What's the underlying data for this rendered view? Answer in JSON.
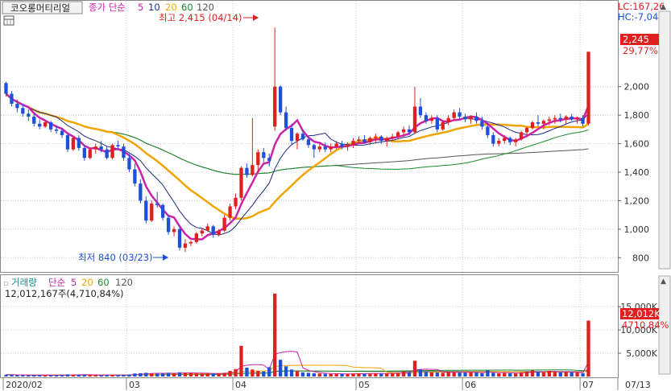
{
  "header": {
    "stock_name": "코오롱머티리얼",
    "price_ma_label": "종가 단순",
    "ma_periods": [
      "5",
      "10",
      "20",
      "60",
      "120"
    ],
    "lc_label": "LC:167,26",
    "hc_label": "HC:-7,04"
  },
  "volume_header": {
    "title": "거래량",
    "ma_label": "단순",
    "ma_periods": [
      "5",
      "20",
      "60",
      "120"
    ],
    "summary": "12,012,167주(4,710,84%)"
  },
  "annotations": {
    "high": "최고 2,415 (04/14)",
    "low": "최저 840 (03/23)"
  },
  "price_badge": {
    "value": "2,245",
    "change": "29,77%"
  },
  "volume_badge": {
    "value": "12,012K",
    "change": "4710,84%"
  },
  "colors": {
    "up": "#e02020",
    "down": "#1f50d8",
    "ma5": "#cc22aa",
    "ma10": "#1a2a88",
    "ma20": "#f0a500",
    "ma60": "#1a8a2a",
    "ma120": "#555555",
    "grid": "#c8c8c8"
  },
  "icons": {
    "window": "window-icon"
  },
  "chart_data": [
    {
      "type": "candlestick",
      "name": "price",
      "ylim": [
        700,
        2450
      ],
      "y_ticks": [
        "800",
        "1,000",
        "1,200",
        "1,400",
        "1,600",
        "1,800",
        "2,000"
      ],
      "x_labels": [
        "2020/02",
        "03",
        "04",
        "05",
        "06",
        "07"
      ],
      "x_label_index": [
        0,
        22,
        41,
        63,
        82,
        103
      ],
      "x_end_label": "07/13",
      "last_close": 2245,
      "change_pct": 29.77,
      "high": {
        "value": 2415,
        "date": "04/14",
        "index": 48
      },
      "low": {
        "value": 840,
        "date": "03/23",
        "index": 32
      },
      "ohlc": [
        [
          2025,
          2035,
          1930,
          1950
        ],
        [
          1950,
          1970,
          1860,
          1880
        ],
        [
          1880,
          1910,
          1820,
          1850
        ],
        [
          1850,
          1880,
          1790,
          1810
        ],
        [
          1810,
          1840,
          1760,
          1790
        ],
        [
          1790,
          1810,
          1720,
          1740
        ],
        [
          1740,
          1770,
          1700,
          1720
        ],
        [
          1720,
          1760,
          1710,
          1750
        ],
        [
          1750,
          1760,
          1680,
          1700
        ],
        [
          1700,
          1730,
          1670,
          1690
        ],
        [
          1690,
          1710,
          1640,
          1660
        ],
        [
          1660,
          1670,
          1540,
          1560
        ],
        [
          1560,
          1650,
          1550,
          1640
        ],
        [
          1640,
          1660,
          1550,
          1570
        ],
        [
          1570,
          1590,
          1480,
          1500
        ],
        [
          1500,
          1570,
          1490,
          1560
        ],
        [
          1560,
          1600,
          1530,
          1580
        ],
        [
          1580,
          1620,
          1540,
          1560
        ],
        [
          1560,
          1580,
          1490,
          1500
        ],
        [
          1500,
          1600,
          1490,
          1590
        ],
        [
          1590,
          1620,
          1560,
          1580
        ],
        [
          1580,
          1600,
          1480,
          1500
        ],
        [
          1500,
          1530,
          1400,
          1420
        ],
        [
          1420,
          1460,
          1300,
          1320
        ],
        [
          1320,
          1350,
          1180,
          1200
        ],
        [
          1200,
          1230,
          1040,
          1060
        ],
        [
          1060,
          1200,
          1050,
          1180
        ],
        [
          1180,
          1260,
          1150,
          1170
        ],
        [
          1170,
          1180,
          1060,
          1080
        ],
        [
          1080,
          1100,
          960,
          980
        ],
        [
          980,
          1020,
          950,
          1000
        ],
        [
          1000,
          1020,
          850,
          870
        ],
        [
          870,
          930,
          840,
          900
        ],
        [
          900,
          920,
          880,
          910
        ],
        [
          910,
          980,
          900,
          970
        ],
        [
          970,
          1010,
          950,
          990
        ],
        [
          990,
          1040,
          980,
          1020
        ],
        [
          1020,
          1030,
          940,
          960
        ],
        [
          960,
          1000,
          950,
          990
        ],
        [
          990,
          1100,
          980,
          1080
        ],
        [
          1080,
          1180,
          1060,
          1160
        ],
        [
          1160,
          1250,
          1140,
          1220
        ],
        [
          1220,
          1440,
          1200,
          1430
        ],
        [
          1430,
          1460,
          1360,
          1380
        ],
        [
          1380,
          1780,
          1370,
          1450
        ],
        [
          1450,
          1560,
          1400,
          1540
        ],
        [
          1540,
          1570,
          1470,
          1500
        ],
        [
          1500,
          1530,
          1440,
          1480
        ],
        [
          1720,
          2415,
          1690,
          2000
        ],
        [
          2000,
          2010,
          1800,
          1820
        ],
        [
          1820,
          1860,
          1690,
          1710
        ],
        [
          1710,
          1740,
          1590,
          1620
        ],
        [
          1620,
          1680,
          1560,
          1670
        ],
        [
          1670,
          1700,
          1620,
          1630
        ],
        [
          1630,
          1650,
          1570,
          1590
        ],
        [
          1590,
          1600,
          1500,
          1560
        ],
        [
          1560,
          1600,
          1540,
          1580
        ],
        [
          1580,
          1610,
          1540,
          1560
        ],
        [
          1560,
          1600,
          1540,
          1580
        ],
        [
          1580,
          1620,
          1560,
          1600
        ],
        [
          1600,
          1620,
          1560,
          1580
        ],
        [
          1580,
          1610,
          1550,
          1590
        ],
        [
          1590,
          1640,
          1570,
          1620
        ],
        [
          1620,
          1650,
          1600,
          1630
        ],
        [
          1630,
          1660,
          1600,
          1610
        ],
        [
          1610,
          1650,
          1590,
          1640
        ],
        [
          1640,
          1670,
          1610,
          1650
        ],
        [
          1650,
          1660,
          1600,
          1620
        ],
        [
          1620,
          1650,
          1580,
          1640
        ],
        [
          1640,
          1670,
          1620,
          1650
        ],
        [
          1650,
          1690,
          1630,
          1680
        ],
        [
          1680,
          1720,
          1650,
          1700
        ],
        [
          1700,
          1730,
          1660,
          1680
        ],
        [
          1680,
          2000,
          1670,
          1860
        ],
        [
          1860,
          1920,
          1780,
          1800
        ],
        [
          1800,
          1820,
          1740,
          1760
        ],
        [
          1760,
          1800,
          1740,
          1780
        ],
        [
          1780,
          1800,
          1680,
          1700
        ],
        [
          1700,
          1760,
          1690,
          1750
        ],
        [
          1750,
          1800,
          1730,
          1780
        ],
        [
          1780,
          1840,
          1760,
          1820
        ],
        [
          1820,
          1850,
          1770,
          1790
        ],
        [
          1790,
          1810,
          1750,
          1770
        ],
        [
          1770,
          1800,
          1740,
          1790
        ],
        [
          1790,
          1820,
          1740,
          1760
        ],
        [
          1760,
          1790,
          1700,
          1720
        ],
        [
          1720,
          1740,
          1640,
          1660
        ],
        [
          1660,
          1680,
          1580,
          1600
        ],
        [
          1600,
          1640,
          1580,
          1620
        ],
        [
          1620,
          1660,
          1600,
          1640
        ],
        [
          1640,
          1650,
          1590,
          1610
        ],
        [
          1610,
          1640,
          1580,
          1630
        ],
        [
          1630,
          1690,
          1620,
          1680
        ],
        [
          1680,
          1720,
          1660,
          1710
        ],
        [
          1710,
          1760,
          1700,
          1750
        ],
        [
          1750,
          1800,
          1720,
          1740
        ],
        [
          1740,
          1770,
          1700,
          1760
        ],
        [
          1760,
          1790,
          1730,
          1770
        ],
        [
          1770,
          1800,
          1740,
          1780
        ],
        [
          1780,
          1810,
          1750,
          1770
        ],
        [
          1770,
          1800,
          1740,
          1790
        ],
        [
          1790,
          1810,
          1760,
          1770
        ],
        [
          1770,
          1790,
          1740,
          1780
        ],
        [
          1780,
          1800,
          1720,
          1740
        ],
        [
          1740,
          2245,
          1730,
          2245
        ]
      ]
    },
    {
      "type": "bar",
      "name": "volume",
      "unit": "K",
      "ylim": [
        0,
        19000
      ],
      "y_ticks": [
        "5,000K",
        "10,000K",
        "15,000K"
      ],
      "last_value": 12012,
      "change_pct": 4710.84,
      "values": [
        380,
        350,
        320,
        300,
        280,
        320,
        300,
        260,
        280,
        300,
        320,
        450,
        380,
        350,
        400,
        330,
        300,
        280,
        320,
        350,
        300,
        380,
        420,
        650,
        720,
        800,
        700,
        600,
        650,
        800,
        700,
        900,
        850,
        700,
        650,
        600,
        700,
        650,
        600,
        800,
        1200,
        1600,
        6600,
        1900,
        1500,
        1200,
        1100,
        2000,
        17800,
        3600,
        2200,
        1500,
        1200,
        900,
        800,
        700,
        650,
        600,
        550,
        600,
        550,
        500,
        650,
        700,
        600,
        650,
        700,
        600,
        650,
        700,
        800,
        1100,
        900,
        3400,
        1500,
        1000,
        900,
        850,
        800,
        1000,
        900,
        850,
        800,
        900,
        850,
        700,
        1300,
        800,
        700,
        750,
        700,
        650,
        900,
        1000,
        1300,
        1100,
        900,
        1200,
        1000,
        900,
        950,
        900,
        850,
        700,
        12012
      ]
    }
  ]
}
